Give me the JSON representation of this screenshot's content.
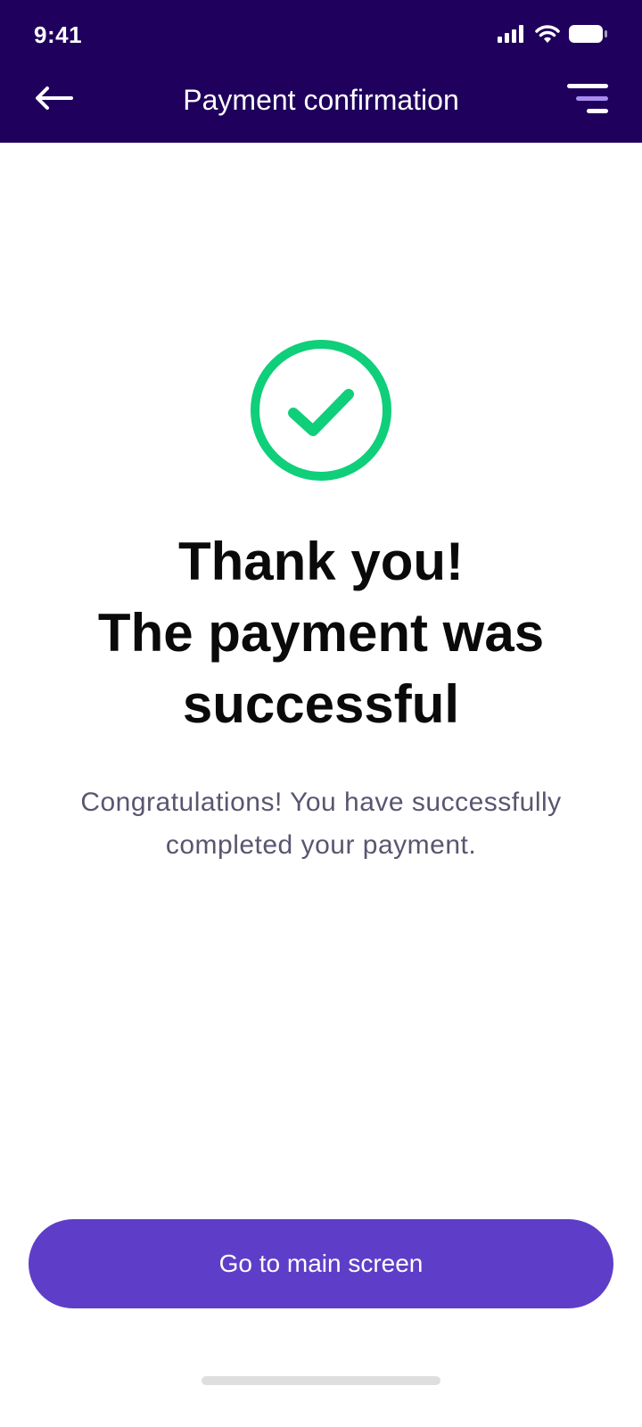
{
  "status_bar": {
    "time": "9:41",
    "icons": [
      "cellular-signal-icon",
      "wifi-icon",
      "battery-icon"
    ]
  },
  "nav": {
    "back_icon": "arrow-left-icon",
    "title": "Payment confirmation",
    "menu_icon": "menu-lines-icon"
  },
  "content": {
    "success_icon": "check-circle-icon",
    "title_lines": [
      "Thank you!",
      "The payment was",
      "successful"
    ],
    "message_lines": [
      "Congratulations! You have successfully",
      "completed your payment."
    ]
  },
  "cta": {
    "label": "Go to main screen"
  },
  "colors": {
    "header_bg": "#1f005c",
    "accent": "#5e3ec8",
    "menu_accent": "#a98cf0",
    "success": "#0fcf7a",
    "title_text": "#0a0a0a",
    "body_text": "#5a5570"
  }
}
